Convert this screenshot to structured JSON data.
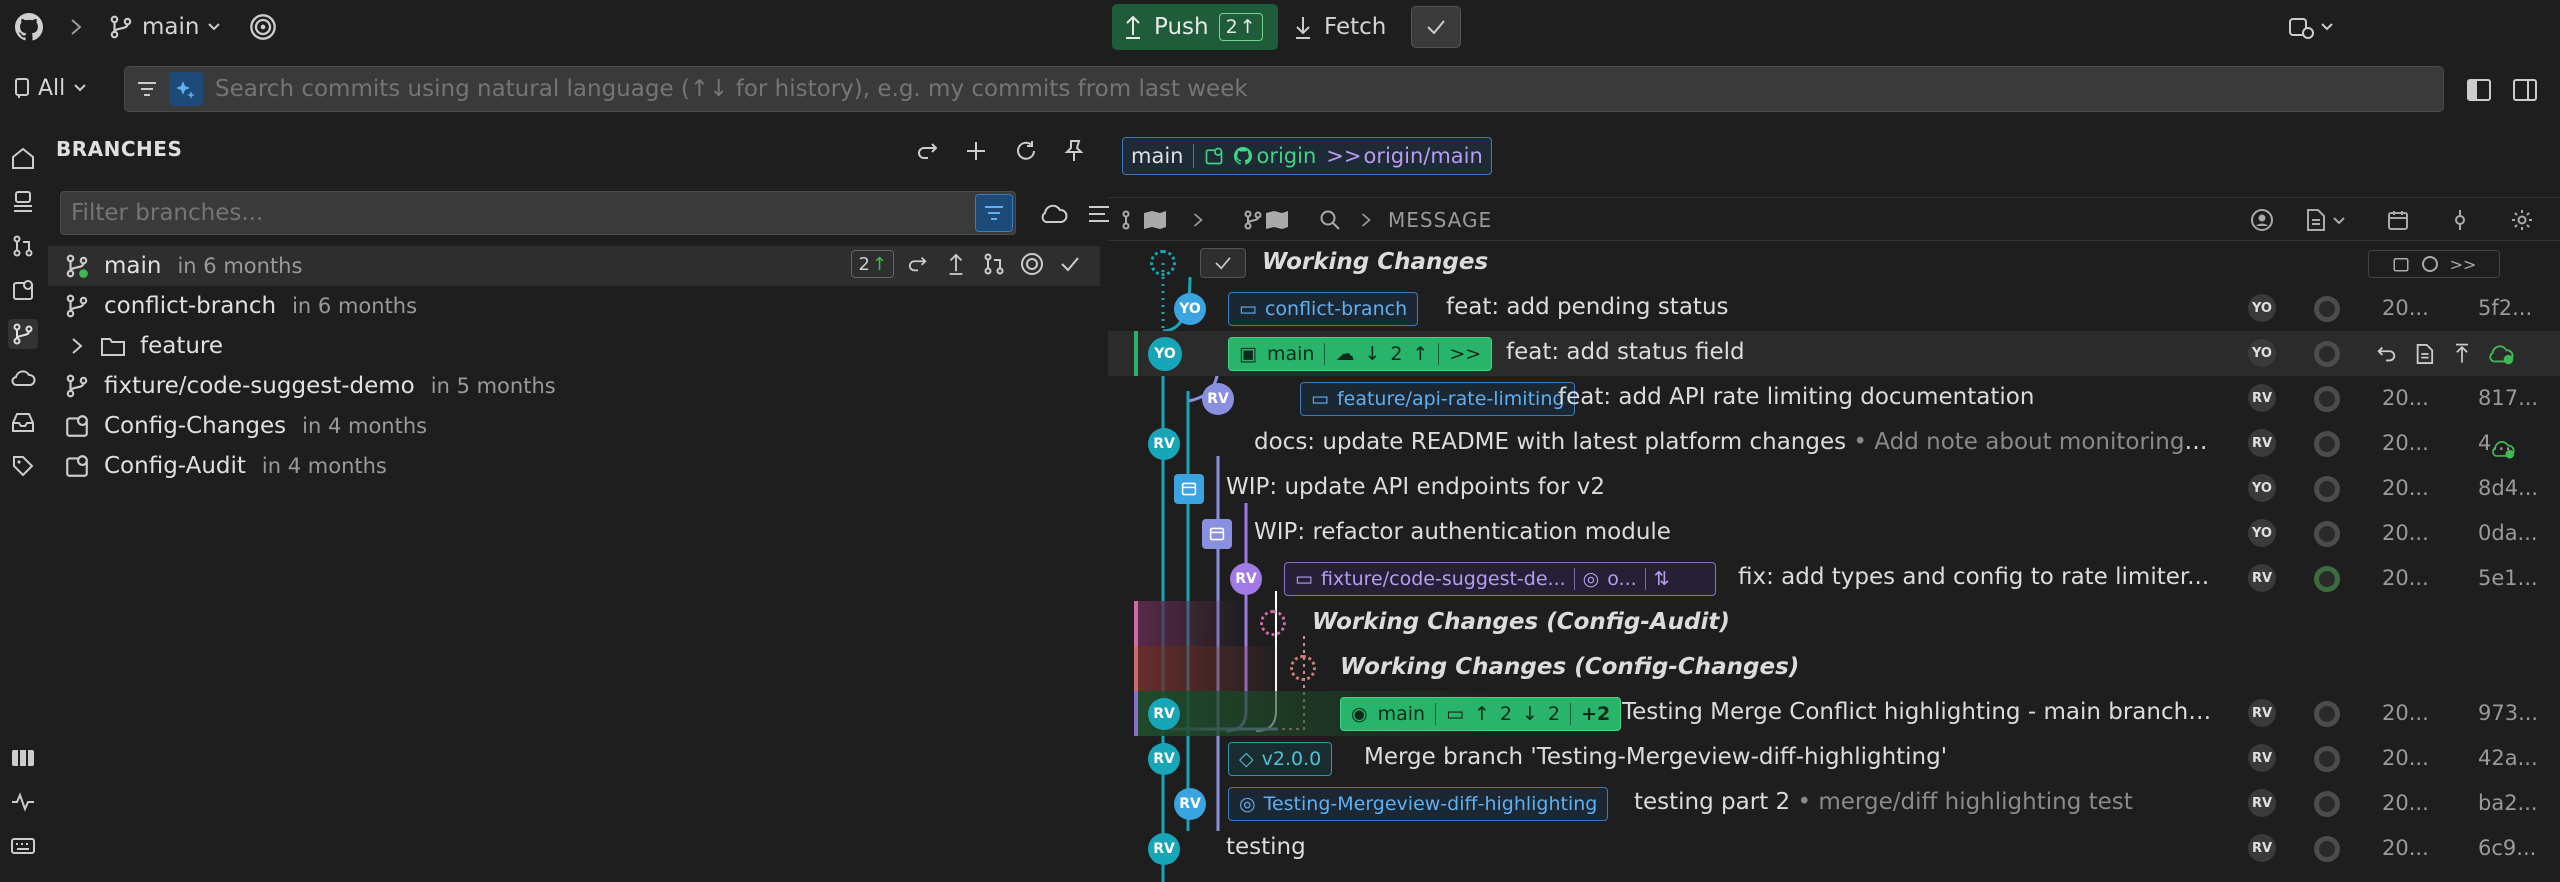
{
  "topbar": {
    "branch": "main",
    "push_label": "Push",
    "push_count": "2",
    "fetch_label": "Fetch"
  },
  "search": {
    "scope": "All",
    "placeholder": "Search commits using natural language (↑↓ for history), e.g. my commits from last week"
  },
  "branches": {
    "title": "BRANCHES",
    "filter_placeholder": "Filter branches...",
    "items": [
      {
        "name": "main",
        "age": "in 6 months",
        "ahead": "2"
      },
      {
        "name": "conflict-branch",
        "age": "in 6 months"
      },
      {
        "name": "feature",
        "age": ""
      },
      {
        "name": "fixture/code-suggest-demo",
        "age": "in 5 months"
      },
      {
        "name": "Config-Changes",
        "age": "in 4 months"
      },
      {
        "name": "Config-Audit",
        "age": "in 4 months"
      }
    ]
  },
  "ref_filter": {
    "branch": "main",
    "remote": "origin",
    "upstream": "origin/main"
  },
  "graph_header": {
    "message_col": "MESSAGE"
  },
  "commits": [
    {
      "message": "Working Changes",
      "wip": true
    },
    {
      "author": "YO",
      "tag": "conflict-branch",
      "message": "feat: add pending status",
      "date": "20...",
      "sha": "5f2..."
    },
    {
      "author": "YO",
      "tag": "main",
      "tag_ahead": "2",
      "message": "feat: add status field",
      "selected": true
    },
    {
      "author": "RV",
      "tag": "feature/api-rate-limiting",
      "message": "feat: add API rate limiting documentation",
      "date": "20...",
      "sha": "817..."
    },
    {
      "author": "RV",
      "message": "docs: update README with latest platform changes",
      "description": "• Add note about monitoring d...",
      "date": "20...",
      "sha": "4..."
    },
    {
      "author": "YO",
      "message": "WIP: update API endpoints for v2",
      "date": "20...",
      "sha": "8d4..."
    },
    {
      "author": "YO",
      "message": "WIP: refactor authentication module",
      "date": "20...",
      "sha": "0da..."
    },
    {
      "author": "RV",
      "tag": "fixture/code-suggest-de...",
      "tag_remote": "o...",
      "message": "fix: add types and config to rate limiter...",
      "date": "20...",
      "sha": "5e1..."
    },
    {
      "message": "Working Changes (Config-Audit)",
      "wip": true
    },
    {
      "message": "Working Changes (Config-Changes)",
      "wip": true
    },
    {
      "author": "RV",
      "tag": "main",
      "tag_counts": "2",
      "tag_counts2": "2",
      "tag_more": "+2",
      "message": "Testing Merge Conflict highlighting - main branch ...",
      "date": "20...",
      "sha": "973..."
    },
    {
      "author": "RV",
      "tag": "v2.0.0",
      "message": "Merge branch 'Testing-Mergeview-diff-highlighting'",
      "date": "20...",
      "sha": "42a..."
    },
    {
      "author": "RV",
      "tag": "Testing-Mergeview-diff-highlighting",
      "message": "testing part 2",
      "description": "• merge/diff highlighting test",
      "date": "20...",
      "sha": "ba2..."
    },
    {
      "author": "RV",
      "message": "testing",
      "date": "20...",
      "sha": "6c9..."
    }
  ],
  "colors": {
    "teal_lane": "#17a6b8",
    "push_bg": "#1f5c3a",
    "main_tag": "#28b46a",
    "blue_tag": "#3b7bc0",
    "purple_tag": "#8a6ec8"
  }
}
